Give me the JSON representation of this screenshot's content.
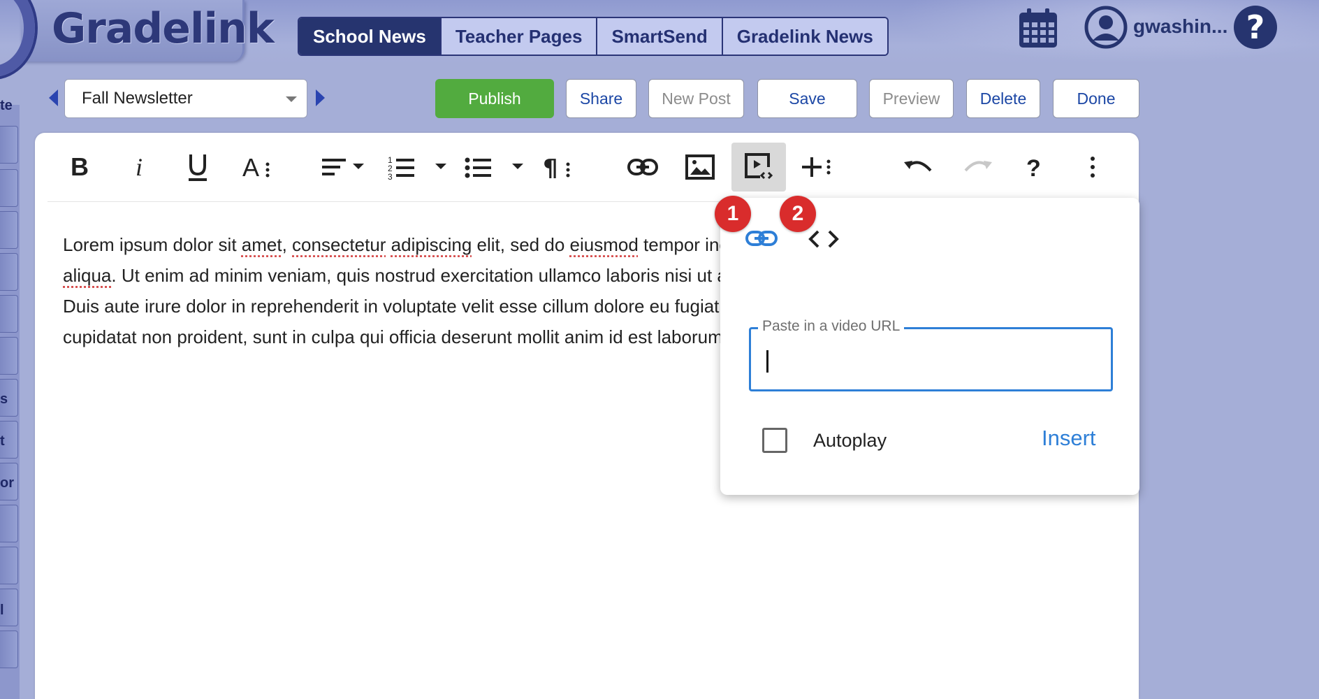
{
  "app": {
    "logo_text": "Gradelink"
  },
  "nav": {
    "tabs": [
      {
        "label": "School News",
        "active": true
      },
      {
        "label": "Teacher Pages",
        "active": false
      },
      {
        "label": "SmartSend",
        "active": false
      },
      {
        "label": "Gradelink News",
        "active": false
      }
    ]
  },
  "user": {
    "name": "gwashin..."
  },
  "help": {
    "glyph": "?"
  },
  "sidebar": {
    "fragments": [
      "te",
      "s",
      "t",
      "or",
      "l"
    ]
  },
  "toolbar": {
    "newsletter_select": "Fall Newsletter",
    "publish": "Publish",
    "share": "Share",
    "new_post": "New Post",
    "save": "Save",
    "preview": "Preview",
    "delete": "Delete",
    "done": "Done"
  },
  "editor_toolbar": {
    "icons": [
      "bold-icon",
      "italic-icon",
      "underline-icon",
      "font-size-icon",
      "align-icon",
      "ordered-list-icon",
      "unordered-list-icon",
      "paragraph-format-icon",
      "insert-link-icon",
      "insert-image-icon",
      "insert-video-icon",
      "insert-more-icon",
      "undo-icon",
      "redo-icon",
      "help-icon",
      "more-options-icon"
    ]
  },
  "editor": {
    "lines": [
      [
        "Lorem ipsum dolor sit ",
        "amet",
        ", ",
        "consectetur",
        " ",
        "adipiscing",
        " elit, sed do ",
        "eiusmod",
        " tempor incididunt ut labore et dolore magna"
      ],
      [
        "aliqua",
        ". Ut enim ad minim veniam, quis nostrud exercitation ullamco laboris nisi ut aliquip ex ea commodo consequat."
      ],
      [
        "Duis aute irure dolor in reprehenderit in voluptate velit esse cillum dolore eu fugiat nulla pariatur. Excepteur sint occaecat"
      ],
      [
        "cupidatat non proident, sunt in culpa qui officia deserunt mollit anim id est laborum."
      ]
    ]
  },
  "video_popup": {
    "badge_1": "1",
    "badge_2": "2",
    "url_label": "Paste in a video URL",
    "url_value": "",
    "autoplay_label": "Autoplay",
    "autoplay_checked": false,
    "insert_label": "Insert"
  },
  "colors": {
    "accent_blue": "#2e7fd7",
    "publish_green": "#52ab3f",
    "nav_active": "#26346f",
    "badge_red": "#d92c2c"
  }
}
